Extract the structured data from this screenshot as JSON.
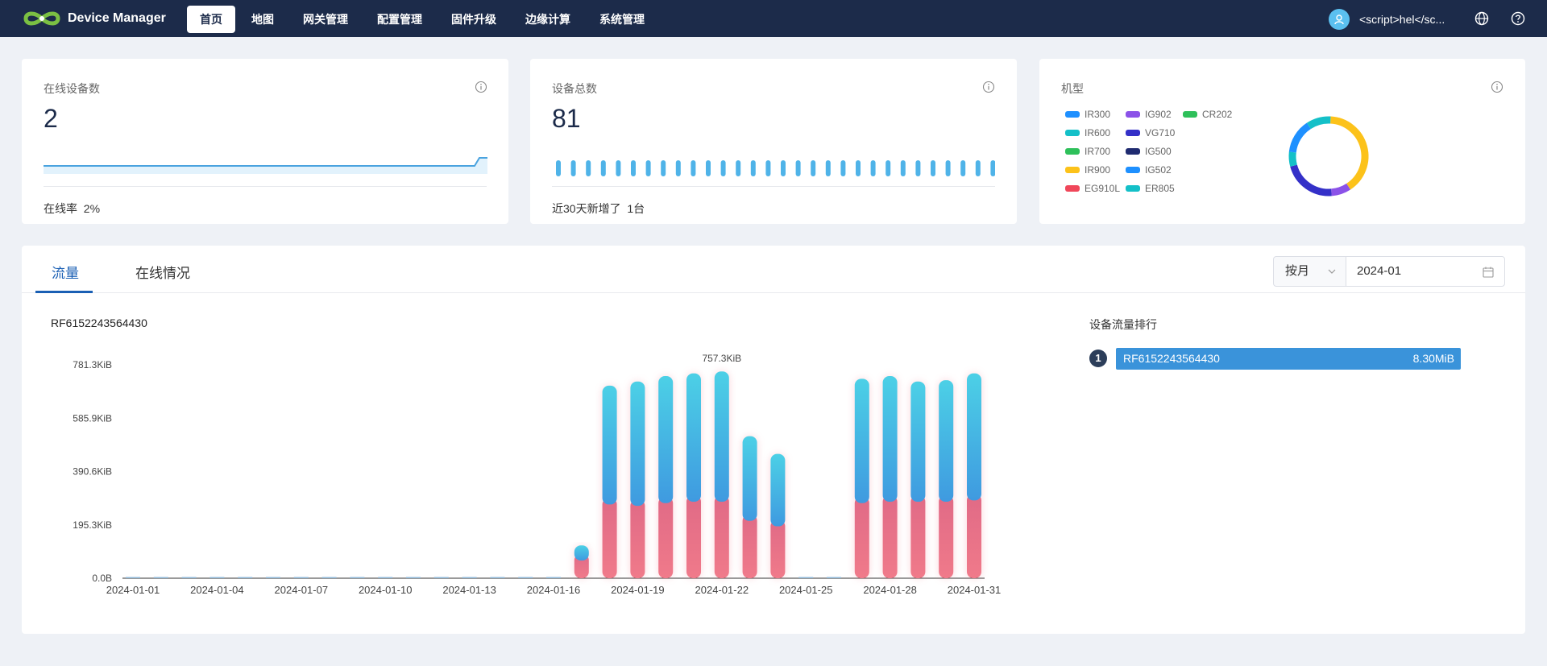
{
  "header": {
    "brand": "Device Manager",
    "nav": [
      {
        "label": "首页",
        "active": true
      },
      {
        "label": "地图"
      },
      {
        "label": "网关管理"
      },
      {
        "label": "配置管理"
      },
      {
        "label": "固件升级"
      },
      {
        "label": "边缘计算"
      },
      {
        "label": "系统管理"
      }
    ],
    "user_name": "<script>hel</sc...",
    "icons": [
      "user-icon",
      "globe-icon",
      "help-icon"
    ]
  },
  "stats": {
    "online": {
      "title": "在线设备数",
      "value": "2",
      "footer_label": "在线率",
      "footer_value": "2%"
    },
    "total": {
      "title": "设备总数",
      "value": "81",
      "footer_label": "近30天新增了",
      "footer_value": "1台"
    },
    "models": {
      "title": "机型",
      "legend": [
        {
          "label": "IR300",
          "color": "#1e90ff"
        },
        {
          "label": "IR600",
          "color": "#14c0c8"
        },
        {
          "label": "IR700",
          "color": "#2ec05a"
        },
        {
          "label": "IR900",
          "color": "#fcc21a"
        },
        {
          "label": "EG910L",
          "color": "#f0475a"
        },
        {
          "label": "IG902",
          "color": "#8b52e8"
        },
        {
          "label": "VG710",
          "color": "#3430c8"
        },
        {
          "label": "IG500",
          "color": "#1f2b70"
        },
        {
          "label": "IG502",
          "color": "#1e90ff"
        },
        {
          "label": "ER805",
          "color": "#14c0c8"
        },
        {
          "label": "CR202",
          "color": "#2ec05a"
        }
      ],
      "donut_share": [
        {
          "label": "IR900",
          "value": 0.4
        },
        {
          "label": "IG902",
          "value": 0.08
        },
        {
          "label": "VG710",
          "value": 0.22
        },
        {
          "label": "IR600",
          "value": 0.06
        },
        {
          "label": "IR300",
          "value": 0.14
        },
        {
          "label": "ER805",
          "value": 0.1
        }
      ]
    }
  },
  "tabs": [
    {
      "label": "流量",
      "active": true
    },
    {
      "label": "在线情况"
    }
  ],
  "filter": {
    "period": "按月",
    "date": "2024-01"
  },
  "device_title": "RF6152243564430",
  "ranking": {
    "title": "设备流量排行",
    "items": [
      {
        "rank": "1",
        "name": "RF6152243564430",
        "value": "8.30MiB"
      }
    ]
  },
  "chart_data": {
    "type": "bar",
    "stacked": true,
    "x": [
      "2024-01-01",
      "2024-01-02",
      "2024-01-03",
      "2024-01-04",
      "2024-01-05",
      "2024-01-06",
      "2024-01-07",
      "2024-01-08",
      "2024-01-09",
      "2024-01-10",
      "2024-01-11",
      "2024-01-12",
      "2024-01-13",
      "2024-01-14",
      "2024-01-15",
      "2024-01-16",
      "2024-01-17",
      "2024-01-18",
      "2024-01-19",
      "2024-01-20",
      "2024-01-21",
      "2024-01-22",
      "2024-01-23",
      "2024-01-24",
      "2024-01-25",
      "2024-01-26",
      "2024-01-27",
      "2024-01-28",
      "2024-01-29",
      "2024-01-30",
      "2024-01-31"
    ],
    "x_tick_labels": [
      "2024-01-01",
      "2024-01-04",
      "2024-01-07",
      "2024-01-10",
      "2024-01-13",
      "2024-01-16",
      "2024-01-19",
      "2024-01-22",
      "2024-01-25",
      "2024-01-28",
      "2024-01-31"
    ],
    "y_tick_labels": [
      "0.0B",
      "195.3KiB",
      "390.6KiB",
      "585.9KiB",
      "781.3KiB"
    ],
    "y_unit": "KiB",
    "ylim": [
      0,
      781.3
    ],
    "series": [
      {
        "values": [
          0,
          0,
          0,
          0,
          0,
          0,
          0,
          0,
          0,
          0,
          0,
          0,
          0,
          0,
          0,
          0,
          65,
          270,
          265,
          275,
          280,
          280,
          210,
          190,
          0,
          0,
          275,
          280,
          280,
          280,
          285
        ]
      },
      {
        "values": [
          0,
          0,
          0,
          0,
          0,
          0,
          0,
          0,
          0,
          0,
          0,
          0,
          0,
          0,
          0,
          0,
          55,
          435,
          455,
          465,
          470,
          477,
          310,
          265,
          0,
          0,
          455,
          460,
          440,
          445,
          465
        ]
      }
    ],
    "series_colors": [
      "#f07a8a",
      "#3f9ae0"
    ],
    "annotation": {
      "x": "2024-01-22",
      "label": "757.3KiB"
    }
  }
}
